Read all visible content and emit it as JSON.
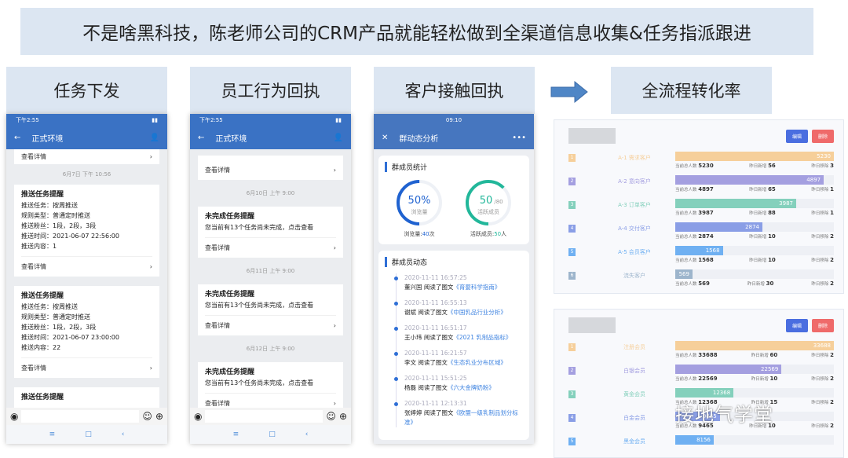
{
  "banner": "不是啥黑科技，陈老师公司的CRM产品就能轻松做到全渠道信息收集&任务指派跟进",
  "headers": [
    "任务下发",
    "员工行为回执",
    "客户接触回执",
    "全流程转化率"
  ],
  "phone": {
    "time": "下午2:55",
    "title": "正式环境",
    "detail": "查看详情"
  },
  "p1": {
    "date": "6月7日 下午 10:56",
    "cards": [
      {
        "title": "推送任务提醒",
        "lines": [
          "推送任务：按周推送",
          "规则类型：普通定时推送",
          "推送粉丝：1段，2段，3段",
          "推送时间：2021-06-07 22:56:00",
          "推送内容：1"
        ]
      },
      {
        "title": "推送任务提醒",
        "lines": [
          "推送任务：按周推送",
          "规则类型：普通定时推送",
          "推送粉丝：1段，2段，3段",
          "推送时间：2021-06-07 23:00:00",
          "推送内容：22"
        ]
      }
    ],
    "last_title": "推送任务提醒"
  },
  "p2": {
    "items": [
      {
        "date": "6月10日 上午 9:00"
      },
      {
        "date": "6月11日 上午 9:00"
      },
      {
        "date": "6月12日 上午 9:00"
      }
    ],
    "title": "未完成任务提醒",
    "text": "您当前有13个任务尚未完成，点击查看"
  },
  "p3": {
    "time": "09:10",
    "title": "群动态分析",
    "stats_title": "群成员统计",
    "ring1": {
      "value": "50%",
      "label": "浏览量",
      "foot": "浏览量:",
      "foot_val": "40",
      "foot_unit": "次",
      "fraction": 0.5
    },
    "ring2": {
      "value": "50",
      "total": "/80",
      "label": "活跃成员",
      "foot": "活跃成员:",
      "foot_val": "50",
      "foot_unit": "人",
      "fraction": 0.625
    },
    "feed_title": "群成员动态",
    "read": "阅读了图文",
    "feed": [
      {
        "t": "2020-11-11 16:57:25",
        "n": "董兴国",
        "a": "《育婴科学指南》"
      },
      {
        "t": "2020-11-11 16:55:13",
        "n": "谢斌",
        "a": "《中国乳品行业分析》"
      },
      {
        "t": "2020-11-11 16:51:17",
        "n": "王小玮",
        "a": "《2021 乳制品指标》"
      },
      {
        "t": "2020-11-11 16:21:57",
        "n": "李文",
        "a": "《生态乳业分布区域》"
      },
      {
        "t": "2020-11-11 15:51:25",
        "n": "杨磊",
        "a": "《六大金牌奶粉》"
      },
      {
        "t": "2020-11-11 12:13:31",
        "n": "张婷婷",
        "a": "《欧盟一级乳制品划分标准》"
      }
    ]
  },
  "funnel": {
    "edit": "编辑",
    "delete": "删除",
    "total_label": "当前总人数",
    "add_label": "昨日新增",
    "rm_label": "昨日移除",
    "colors": [
      "#f6cf9a",
      "#a49fe0",
      "#84d0bc",
      "#8a9ee6",
      "#6fb0f2",
      "#9db5cc"
    ],
    "panel1": [
      {
        "name": "A-1 需求客户",
        "v": 5230,
        "add": 56,
        "rm": 3
      },
      {
        "name": "A-2 意向客户",
        "v": 4897,
        "add": 65,
        "rm": 1
      },
      {
        "name": "A-3 订单客户",
        "v": 3987,
        "add": 88,
        "rm": 1
      },
      {
        "name": "A-4 交付客户",
        "v": 2874,
        "add": 10,
        "rm": 2
      },
      {
        "name": "A-5 会员客户",
        "v": 1568,
        "add": 10,
        "rm": 2
      },
      {
        "name": "流失客户",
        "v": 569,
        "add": 30,
        "rm": 2
      }
    ],
    "panel2": [
      {
        "name": "注册会员",
        "v": 33688,
        "add": 60,
        "rm": 2
      },
      {
        "name": "白银会员",
        "v": 22569,
        "add": 10,
        "rm": 2
      },
      {
        "name": "黄金会员",
        "v": 12368,
        "add": 15,
        "rm": 2
      },
      {
        "name": "白金会员",
        "v": 9465,
        "add": 10,
        "rm": 2
      },
      {
        "name": "黑金会员",
        "v": 8156,
        "add": null,
        "rm": null
      }
    ]
  },
  "watermark": "接地气学堂"
}
